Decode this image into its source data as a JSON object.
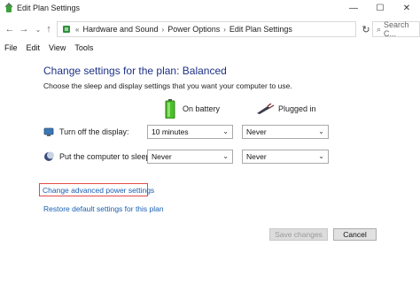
{
  "window": {
    "title": "Edit Plan Settings"
  },
  "addressbar": {
    "overflow": "«",
    "crumbs": [
      "Hardware and Sound",
      "Power Options",
      "Edit Plan Settings"
    ],
    "search_placeholder": "Search C..."
  },
  "menu": [
    "File",
    "Edit",
    "View",
    "Tools"
  ],
  "main": {
    "heading": "Change settings for the plan: Balanced",
    "subtitle": "Choose the sleep and display settings that you want your computer to use.",
    "columns": {
      "battery": "On battery",
      "plugged": "Plugged in"
    },
    "rows": [
      {
        "label": "Turn off the display:",
        "battery": "10 minutes",
        "plugged": "Never"
      },
      {
        "label": "Put the computer to sleep:",
        "battery": "Never",
        "plugged": "Never"
      }
    ],
    "links": {
      "advanced": "Change advanced power settings",
      "restore": "Restore default settings for this plan"
    }
  },
  "buttons": {
    "save": "Save changes",
    "cancel": "Cancel"
  },
  "colors": {
    "heading": "#1e3287",
    "link": "#1a5fb4",
    "highlight": "#e24c4c"
  }
}
